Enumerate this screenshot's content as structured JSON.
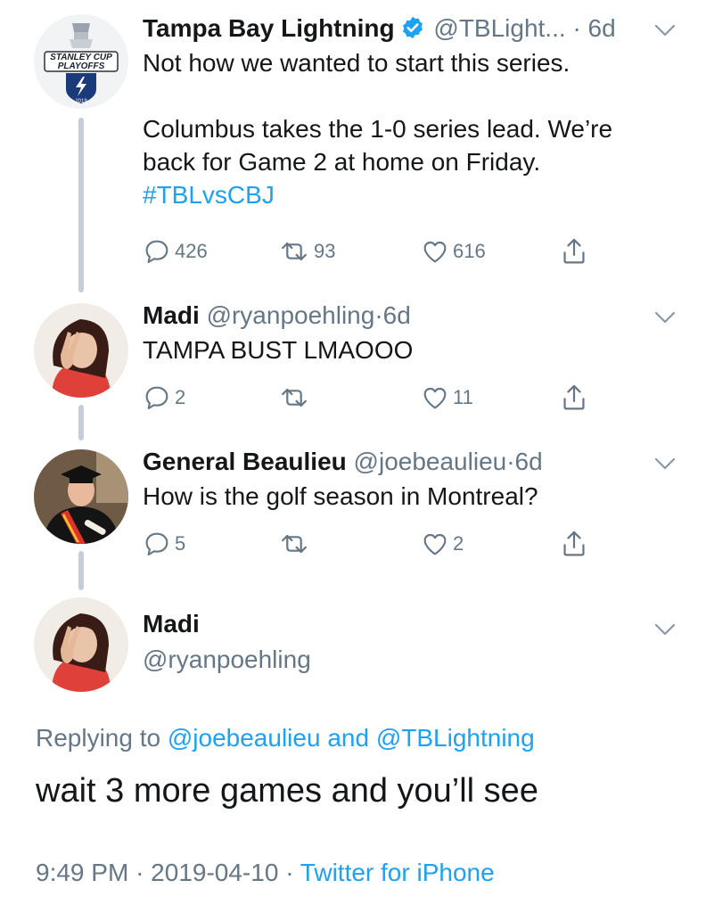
{
  "tweet1": {
    "name": "Tampa Bay Lightning",
    "handle": "@TBLight...",
    "separator": "·",
    "time": "6d",
    "line1": "Not how we wanted to start this series.",
    "line2": "Columbus takes the 1-0 series lead. We’re",
    "line3": "back for Game 2 at home on Friday.",
    "hashtag": "#TBLvsCBJ",
    "replies": "426",
    "retweets": "93",
    "likes": "616",
    "avatar_text_top": "STANLEY CUP",
    "avatar_text_bottom": "PLAYOFFS",
    "avatar_year": "2019"
  },
  "tweet2": {
    "name": "Madi",
    "handle": "@ryanpoehling",
    "separator": "·",
    "time": "6d",
    "text": "TAMPA BUST LMAOOO",
    "replies": "2",
    "retweets": "",
    "likes": "11"
  },
  "tweet3": {
    "name": "General Beaulieu",
    "handle": "@joebeaulieu",
    "separator": "·",
    "time": "6d",
    "text": "How is the golf season in Montreal?",
    "replies": "5",
    "retweets": "",
    "likes": "2"
  },
  "focus": {
    "name": "Madi",
    "handle": "@ryanpoehling",
    "replying_prefix": "Replying to",
    "replying_user1": "@joebeaulieu",
    "replying_and": "and",
    "replying_user2": "@TBLightning",
    "text": "wait 3 more games and you’ll see",
    "time": "9:49 PM",
    "separator": "·",
    "date": "2019-04-10",
    "source": "Twitter for iPhone"
  },
  "colors": {
    "link": "#1da1f2",
    "secondary": "#657786",
    "primary": "#14171a",
    "thread_line": "#c5ced6"
  }
}
